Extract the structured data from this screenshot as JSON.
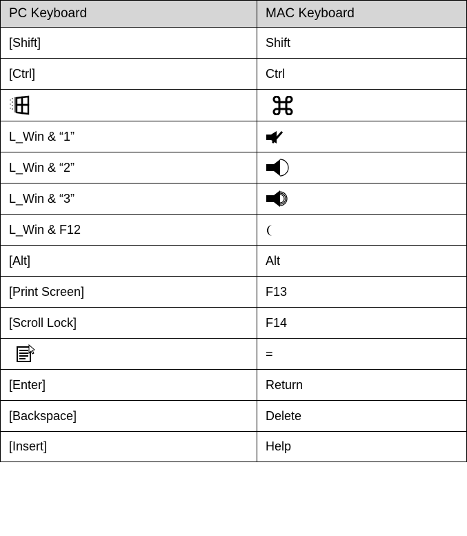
{
  "table": {
    "headers": [
      "PC Keyboard",
      "MAC Keyboard"
    ],
    "rows": [
      {
        "pc": "[Shift]",
        "mac": "Shift"
      },
      {
        "pc": "[Ctrl]",
        "mac": "Ctrl"
      },
      {
        "pc_icon": "windows-logo-icon",
        "mac_icon": "command-icon"
      },
      {
        "pc": "L_Win & “1”",
        "mac_icon": "mute-icon"
      },
      {
        "pc": "L_Win & “2”",
        "mac_icon": "volume-down-icon"
      },
      {
        "pc": "L_Win & “3”",
        "mac_icon": "volume-up-icon"
      },
      {
        "pc": "L_Win & F12",
        "mac_icon": "crescent-moon-icon"
      },
      {
        "pc": "[Alt]",
        "mac": "Alt"
      },
      {
        "pc": "[Print Screen]",
        "mac": "F13"
      },
      {
        "pc": "[Scroll Lock]",
        "mac": "F14"
      },
      {
        "pc_icon": "application-menu-icon",
        "mac": "="
      },
      {
        "pc": "[Enter]",
        "mac": "Return"
      },
      {
        "pc": "[Backspace]",
        "mac": "Delete"
      },
      {
        "pc": "[Insert]",
        "mac": "Help"
      }
    ]
  }
}
